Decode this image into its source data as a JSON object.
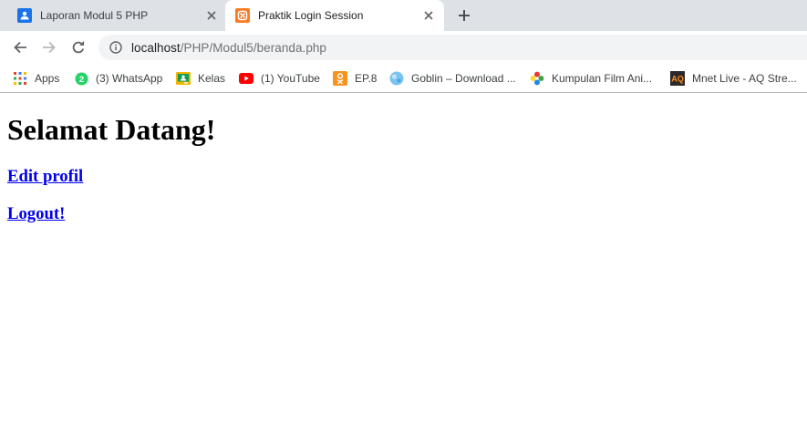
{
  "tabs": [
    {
      "title": "Laporan Modul 5 PHP",
      "favicon": "user-badge-icon",
      "active": false
    },
    {
      "title": "Praktik Login Session",
      "favicon": "xampp-icon",
      "active": true
    }
  ],
  "toolbar": {
    "url_host": "localhost",
    "url_path": "/PHP/Modul5/beranda.php"
  },
  "bookmarks": [
    {
      "label": "Apps",
      "icon": "apps-grid-icon"
    },
    {
      "label": "(3) WhatsApp",
      "icon": "whatsapp-icon"
    },
    {
      "label": "Kelas",
      "icon": "classroom-icon"
    },
    {
      "label": "(1) YouTube",
      "icon": "youtube-icon"
    },
    {
      "label": "EP.8",
      "icon": "ok-icon"
    },
    {
      "label": "Goblin – Download ...",
      "icon": "globe-icon"
    },
    {
      "label": "Kumpulan Film Ani...",
      "icon": "pinwheel-icon"
    },
    {
      "label": "Mnet Live - AQ Stre...",
      "icon": "aq-icon"
    }
  ],
  "page": {
    "heading": "Selamat Datang!",
    "links": [
      "Edit profil",
      "Logout!"
    ]
  },
  "colors": {
    "tab_strip": "#dee1e6",
    "omnibox": "#f1f3f4",
    "link": "#0000ee"
  }
}
